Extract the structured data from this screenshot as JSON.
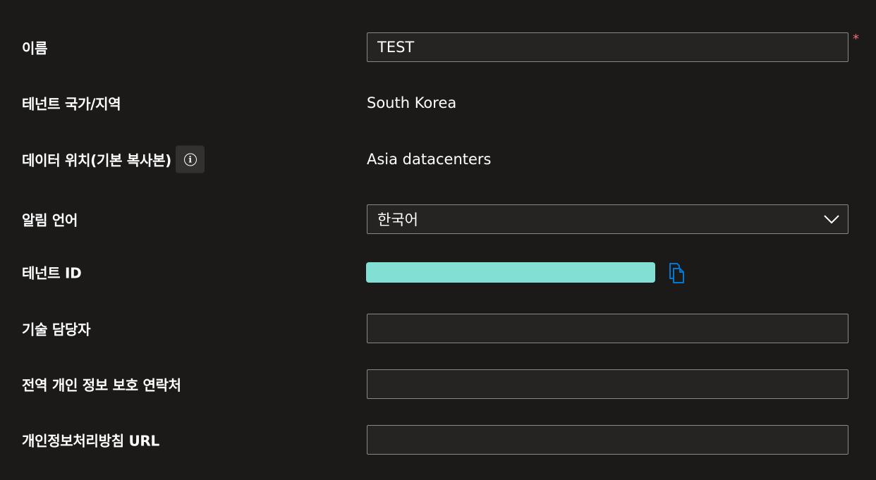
{
  "form": {
    "name": {
      "label": "이름",
      "value": "TEST",
      "required_mark": "*"
    },
    "tenant_country": {
      "label": "테넌트 국가/지역",
      "value": "South Korea"
    },
    "data_location": {
      "label": "데이터 위치(기본 복사본)",
      "value": "Asia datacenters",
      "info_icon": "info-icon"
    },
    "notification_language": {
      "label": "알림 언어",
      "selected": "한국어",
      "icon": "chevron-down-icon"
    },
    "tenant_id": {
      "label": "테넌트 ID",
      "value": "",
      "copy_icon": "copy-icon",
      "mask_color": "#81e0d3"
    },
    "technical_contact": {
      "label": "기술 담당자",
      "value": ""
    },
    "global_privacy_contact": {
      "label": "전역 개인 정보 보호 연락처",
      "value": ""
    },
    "privacy_statement_url": {
      "label": "개인정보처리방침 URL",
      "value": ""
    }
  },
  "colors": {
    "background": "#1b1a19",
    "field_background": "#252423",
    "field_border": "#8a8886",
    "accent": "#0078d4",
    "required": "#f1707b"
  }
}
